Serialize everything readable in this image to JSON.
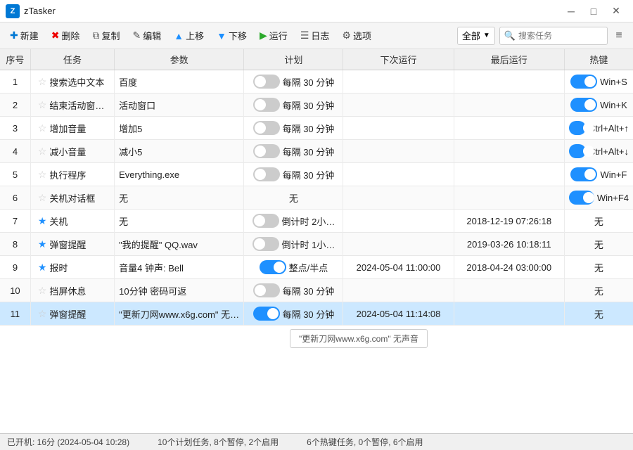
{
  "titleBar": {
    "appName": "zTasker",
    "appIcon": "Z",
    "minBtn": "─",
    "maxBtn": "□",
    "closeBtn": "✕"
  },
  "toolbar": {
    "newBtn": "新建",
    "deleteBtn": "删除",
    "copyBtn": "复制",
    "editBtn": "编辑",
    "upBtn": "上移",
    "downBtn": "下移",
    "runBtn": "运行",
    "logBtn": "日志",
    "optionBtn": "选项",
    "filterLabel": "全部",
    "searchPlaceholder": "搜索任务"
  },
  "table": {
    "headers": [
      "序号",
      "任务",
      "参数",
      "计划",
      "下次运行",
      "最后运行",
      "热键"
    ],
    "rows": [
      {
        "id": 1,
        "star": false,
        "name": "搜索选中文本",
        "param": "百度",
        "toggleOn": false,
        "plan": "每隔 30 分钟",
        "nextRun": "",
        "lastRun": "",
        "hotkey": "Win+S",
        "hotkeyOn": true
      },
      {
        "id": 2,
        "star": false,
        "name": "结束活动窗…",
        "param": "活动窗口",
        "toggleOn": false,
        "plan": "每隔 30 分钟",
        "nextRun": "",
        "lastRun": "",
        "hotkey": "Win+K",
        "hotkeyOn": true
      },
      {
        "id": 3,
        "star": false,
        "name": "增加音量",
        "param": "增加5",
        "toggleOn": false,
        "plan": "每隔 30 分钟",
        "nextRun": "",
        "lastRun": "",
        "hotkey": "Ctrl+Alt+↑",
        "hotkeyOn": true
      },
      {
        "id": 4,
        "star": false,
        "name": "减小音量",
        "param": "减小5",
        "toggleOn": false,
        "plan": "每隔 30 分钟",
        "nextRun": "",
        "lastRun": "",
        "hotkey": "Ctrl+Alt+↓",
        "hotkeyOn": true
      },
      {
        "id": 5,
        "star": false,
        "name": "执行程序",
        "param": "Everything.exe",
        "toggleOn": false,
        "plan": "每隔 30 分钟",
        "nextRun": "",
        "lastRun": "",
        "hotkey": "Win+F",
        "hotkeyOn": true
      },
      {
        "id": 6,
        "star": false,
        "name": "关机对话框",
        "param": "无",
        "toggleOn": null,
        "plan": "无",
        "nextRun": "",
        "lastRun": "",
        "hotkey": "Win+F4",
        "hotkeyOn": true
      },
      {
        "id": 7,
        "star": true,
        "name": "关机",
        "param": "无",
        "toggleOn": false,
        "plan": "倒计时 2小…",
        "nextRun": "",
        "lastRun": "2018-12-19 07:26:18",
        "hotkey": "无",
        "hotkeyOn": null
      },
      {
        "id": 8,
        "star": true,
        "name": "弹窗提醒",
        "param": "\"我的提醒\" QQ.wav",
        "toggleOn": false,
        "plan": "倒计时 1小…",
        "nextRun": "",
        "lastRun": "2019-03-26 10:18:11",
        "hotkey": "无",
        "hotkeyOn": null
      },
      {
        "id": 9,
        "star": true,
        "name": "报时",
        "param": "音量4 钟声: Bell",
        "toggleOn": true,
        "plan": "整点/半点",
        "nextRun": "2024-05-04 11:00:00",
        "lastRun": "2018-04-24 03:00:00",
        "hotkey": "无",
        "hotkeyOn": null
      },
      {
        "id": 10,
        "star": false,
        "name": "挡屏休息",
        "param": "10分钟 密码可返",
        "toggleOn": false,
        "plan": "每隔 30 分钟",
        "nextRun": "",
        "lastRun": "",
        "hotkey": "无",
        "hotkeyOn": null
      },
      {
        "id": 11,
        "star": false,
        "name": "弹窗提醒",
        "param": "\"更新刀网www.x6g.com\" 无…",
        "toggleOn": true,
        "plan": "每隔 30 分钟",
        "nextRun": "2024-05-04 11:14:08",
        "lastRun": "",
        "hotkey": "无",
        "hotkeyOn": null,
        "selected": true
      }
    ],
    "tooltip": "\"更新刀网www.x6g.com\" 无声音"
  },
  "statusBar": {
    "bootTime": "已开机: 16分 (2024-05-04 10:28)",
    "taskStats": "10个计划任务, 8个暂停, 2个启用",
    "hotkeyStats": "6个热键任务, 0个暂停, 6个启用"
  }
}
